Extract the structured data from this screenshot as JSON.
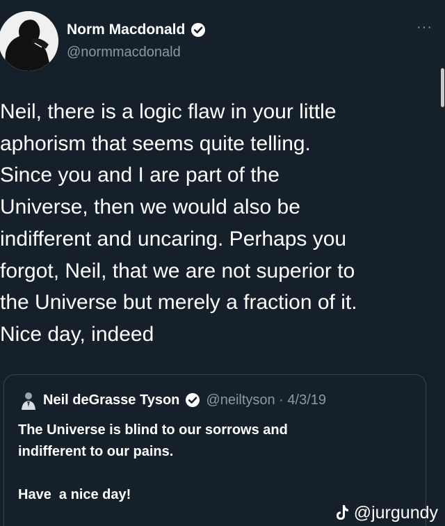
{
  "author": {
    "name": "Norm Macdonald",
    "handle": "@normmacdonald"
  },
  "more_label": "···",
  "tweet": {
    "text": "Neil, there is a logic flaw in your little\naphorism that seems quite telling.\nSince you and I are part of the\nUniverse, then we would also be\nindifferent and uncaring. Perhaps you\nforgot, Neil, that we are not superior to\nthe Universe but merely a fraction of it.\nNice day, indeed"
  },
  "quoted": {
    "name": "Neil deGrasse Tyson",
    "meta": "@neiltyson · 4/3/19",
    "line1": "The Universe is blind to our sorrows and",
    "line2": "indifferent to our pains.",
    "line3": "Have  a nice day!"
  },
  "watermark": {
    "text": "@jurgundy"
  },
  "icons": {
    "verified": "verified-badge-icon",
    "more": "more-options-icon",
    "tiktok": "tiktok-logo-icon"
  },
  "colors": {
    "background": "#15202b",
    "secondary_text": "#8b98a5",
    "border": "#38444d"
  }
}
